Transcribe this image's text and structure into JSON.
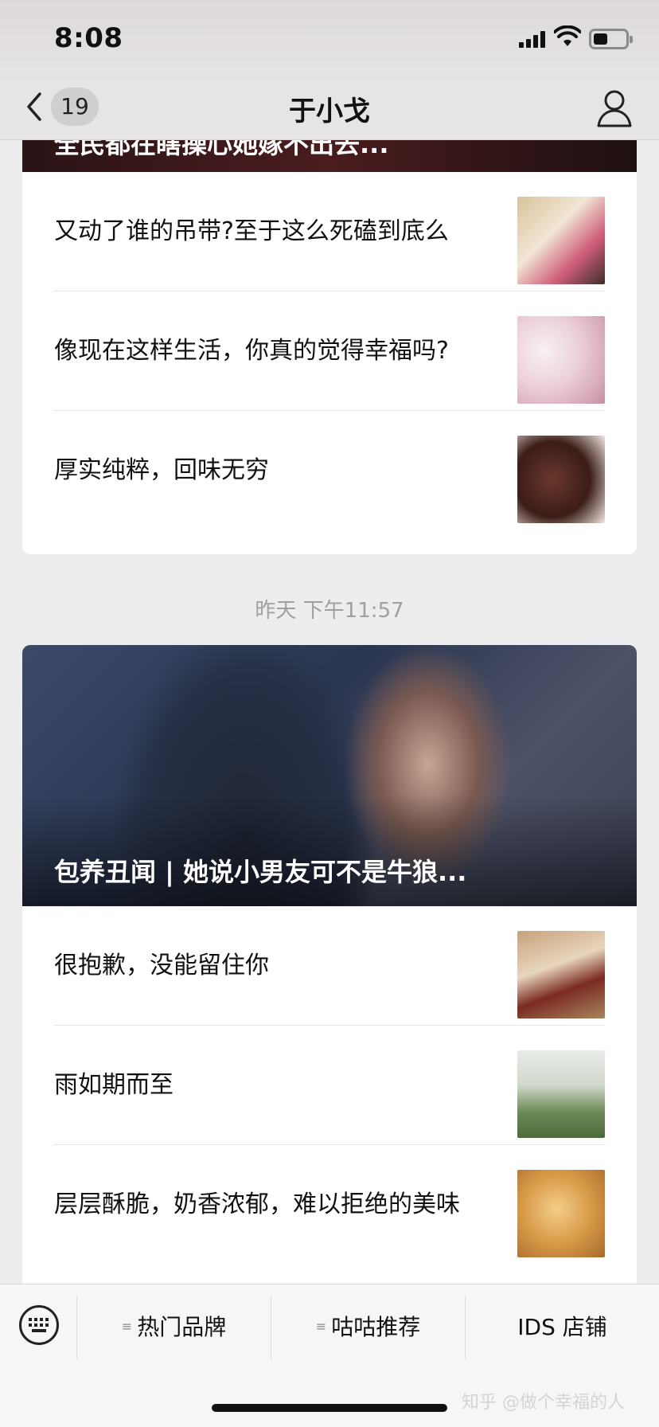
{
  "status_bar": {
    "time": "8:08"
  },
  "nav": {
    "unread_count": "19",
    "title": "于小戈"
  },
  "group1": {
    "cover_title": "全民都在瞎操心她嫁不出去...",
    "articles": [
      {
        "title": "又动了谁的吊带?至于这么死磕到底么",
        "thumb": "girls-photo"
      },
      {
        "title": "像现在这样生活，你真的觉得幸福吗?",
        "thumb": "flowers-photo"
      },
      {
        "title": "厚实纯粹，回味无穷",
        "thumb": "chocolate-photo"
      }
    ]
  },
  "timestamp": "昨天 下午11:57",
  "group2": {
    "cover_title": "包养丑闻 | 她说小男友可不是牛狼...",
    "articles": [
      {
        "title": "很抱歉，没能留住你",
        "thumb": "painting-photo"
      },
      {
        "title": "雨如期而至",
        "thumb": "umbrella-photo"
      },
      {
        "title": "层层酥脆，奶香浓郁，难以拒绝的美味",
        "thumb": "pastry-photo"
      }
    ]
  },
  "menu": {
    "items": [
      {
        "label": "热门品牌"
      },
      {
        "label": "咕咕推荐"
      },
      {
        "label": "IDS 店铺"
      }
    ]
  },
  "watermark": "知乎 @做个幸福的人"
}
